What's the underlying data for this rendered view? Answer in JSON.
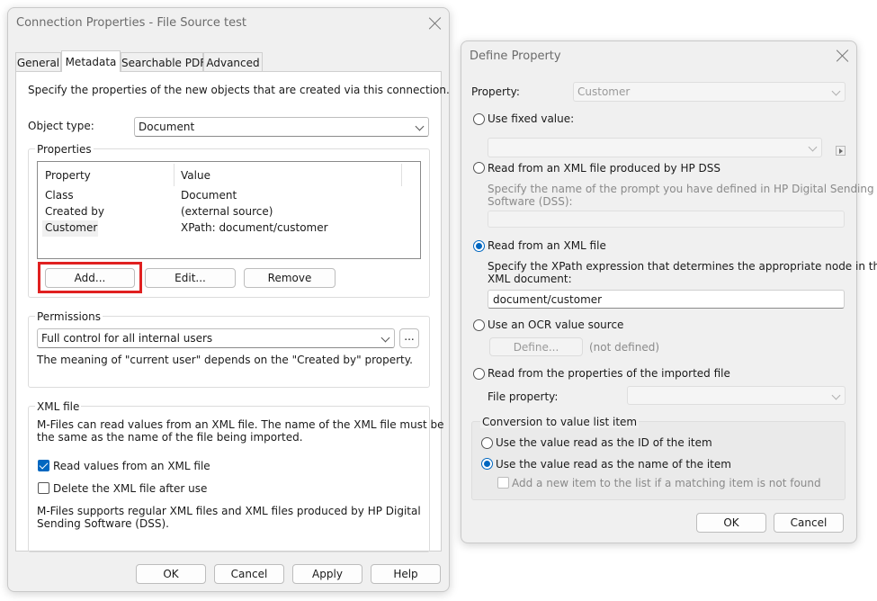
{
  "connection_dialog": {
    "title": "Connection Properties - File Source test",
    "tabs": [
      "General",
      "Metadata",
      "Searchable PDF",
      "Advanced"
    ],
    "description": "Specify the properties of the new objects that are created via this connection.",
    "object_type_label": "Object type:",
    "object_type_value": "Document",
    "properties_group": "Properties",
    "properties_columns": [
      "Property",
      "Value"
    ],
    "properties_rows": [
      {
        "property": "Class",
        "value": "Document"
      },
      {
        "property": "Created by",
        "value": "(external source)"
      },
      {
        "property": "Customer",
        "value": "XPath: document/customer"
      }
    ],
    "add_button": "Add...",
    "edit_button": "Edit...",
    "remove_button": "Remove",
    "permissions_group": "Permissions",
    "permissions_value": "Full control for all internal users",
    "permissions_browse": "...",
    "permissions_note": "The meaning of \"current user\" depends on the \"Created by\" property.",
    "xml_group": "XML file",
    "xml_text_line1": "M-Files can read values from an XML file. The name of the XML file must be",
    "xml_text_line2": "the same as the name of the file being imported.",
    "read_xml_checkbox": "Read values from an XML file",
    "delete_xml_checkbox": "Delete the XML file after use",
    "xml_support_line1": "M-Files supports regular XML files and XML files produced by HP Digital",
    "xml_support_line2": "Sending Software (DSS).",
    "ok_button": "OK",
    "cancel_button": "Cancel",
    "apply_button": "Apply",
    "help_button": "Help"
  },
  "define_dialog": {
    "title": "Define Property",
    "property_label": "Property:",
    "property_value": "Customer",
    "fixed_value_option": "Use fixed value:",
    "hp_dss_option": "Read from an XML file produced by HP DSS",
    "hp_dss_hint_line1": "Specify the name of the prompt you have defined in HP Digital Sending",
    "hp_dss_hint_line2": "Software (DSS):",
    "xml_option": "Read from an XML file",
    "xpath_hint_line1": "Specify the XPath expression that determines the appropriate node in the",
    "xpath_hint_line2": "XML document:",
    "xpath_value": "document/customer",
    "ocr_option": "Use an OCR value source",
    "define_button": "Define...",
    "not_defined": "(not defined)",
    "imported_file_option": "Read from the properties of the imported file",
    "file_property_label": "File property:",
    "conversion_group": "Conversion to value list item",
    "use_id_option": "Use the value read as the ID of the item",
    "use_name_option": "Use the value read as the name of the item",
    "add_new_item_checkbox": "Add a new item to the list if a matching item is not found",
    "ok_button": "OK",
    "cancel_button": "Cancel"
  }
}
